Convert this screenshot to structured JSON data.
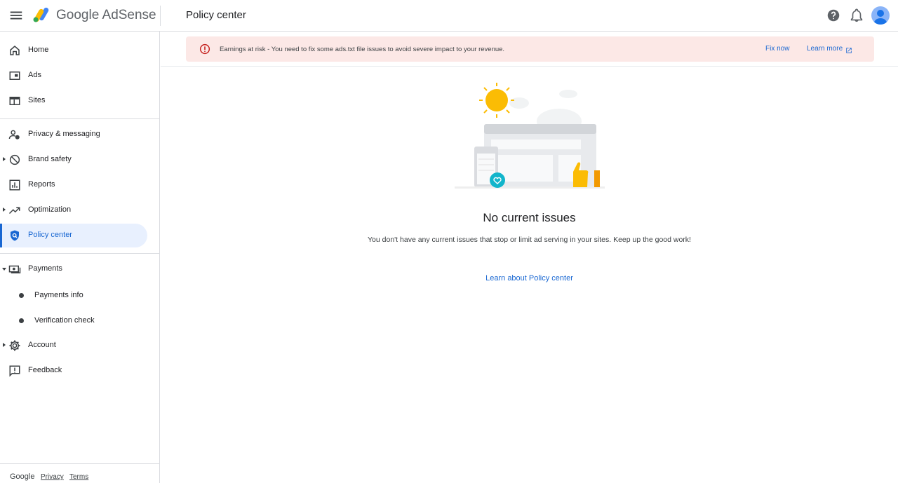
{
  "app": {
    "brand_google": "Google",
    "brand_product": "AdSense",
    "page_title": "Policy center"
  },
  "icons": {
    "menu": "hamburger-menu-icon",
    "help": "help-icon",
    "notifications": "bell-icon",
    "account": "avatar"
  },
  "sidebar": {
    "items": [
      {
        "label": "Home",
        "icon": "home-icon"
      },
      {
        "label": "Ads",
        "icon": "ads-icon"
      },
      {
        "label": "Sites",
        "icon": "sites-icon"
      },
      {
        "label": "Privacy & messaging",
        "icon": "privacy-icon"
      },
      {
        "label": "Brand safety",
        "icon": "block-icon",
        "expandable": true
      },
      {
        "label": "Reports",
        "icon": "reports-icon"
      },
      {
        "label": "Optimization",
        "icon": "trending-icon",
        "expandable": true
      },
      {
        "label": "Policy center",
        "icon": "shield-icon",
        "active": true
      },
      {
        "label": "Payments",
        "icon": "payments-icon",
        "expanded": true
      },
      {
        "label": "Account",
        "icon": "gear-icon",
        "expandable": true
      },
      {
        "label": "Feedback",
        "icon": "feedback-icon"
      }
    ],
    "payments_sub": [
      {
        "label": "Payments info"
      },
      {
        "label": "Verification check"
      }
    ],
    "footer": {
      "google": "Google",
      "privacy": "Privacy",
      "terms": "Terms"
    }
  },
  "banner": {
    "message": "Earnings at risk - You need to fix some ads.txt file issues to avoid severe impact to your revenue.",
    "fix_label": "Fix now",
    "learn_label": "Learn more",
    "color": "#fce8e6",
    "icon_color": "#c5221f"
  },
  "main": {
    "heading": "No current issues",
    "subtext": "You don't have any current issues that stop or limit ad serving in your sites. Keep up the good work!",
    "link": "Learn about Policy center"
  },
  "colors": {
    "accent": "#1967d2",
    "active_bg": "#e8f0fe"
  }
}
